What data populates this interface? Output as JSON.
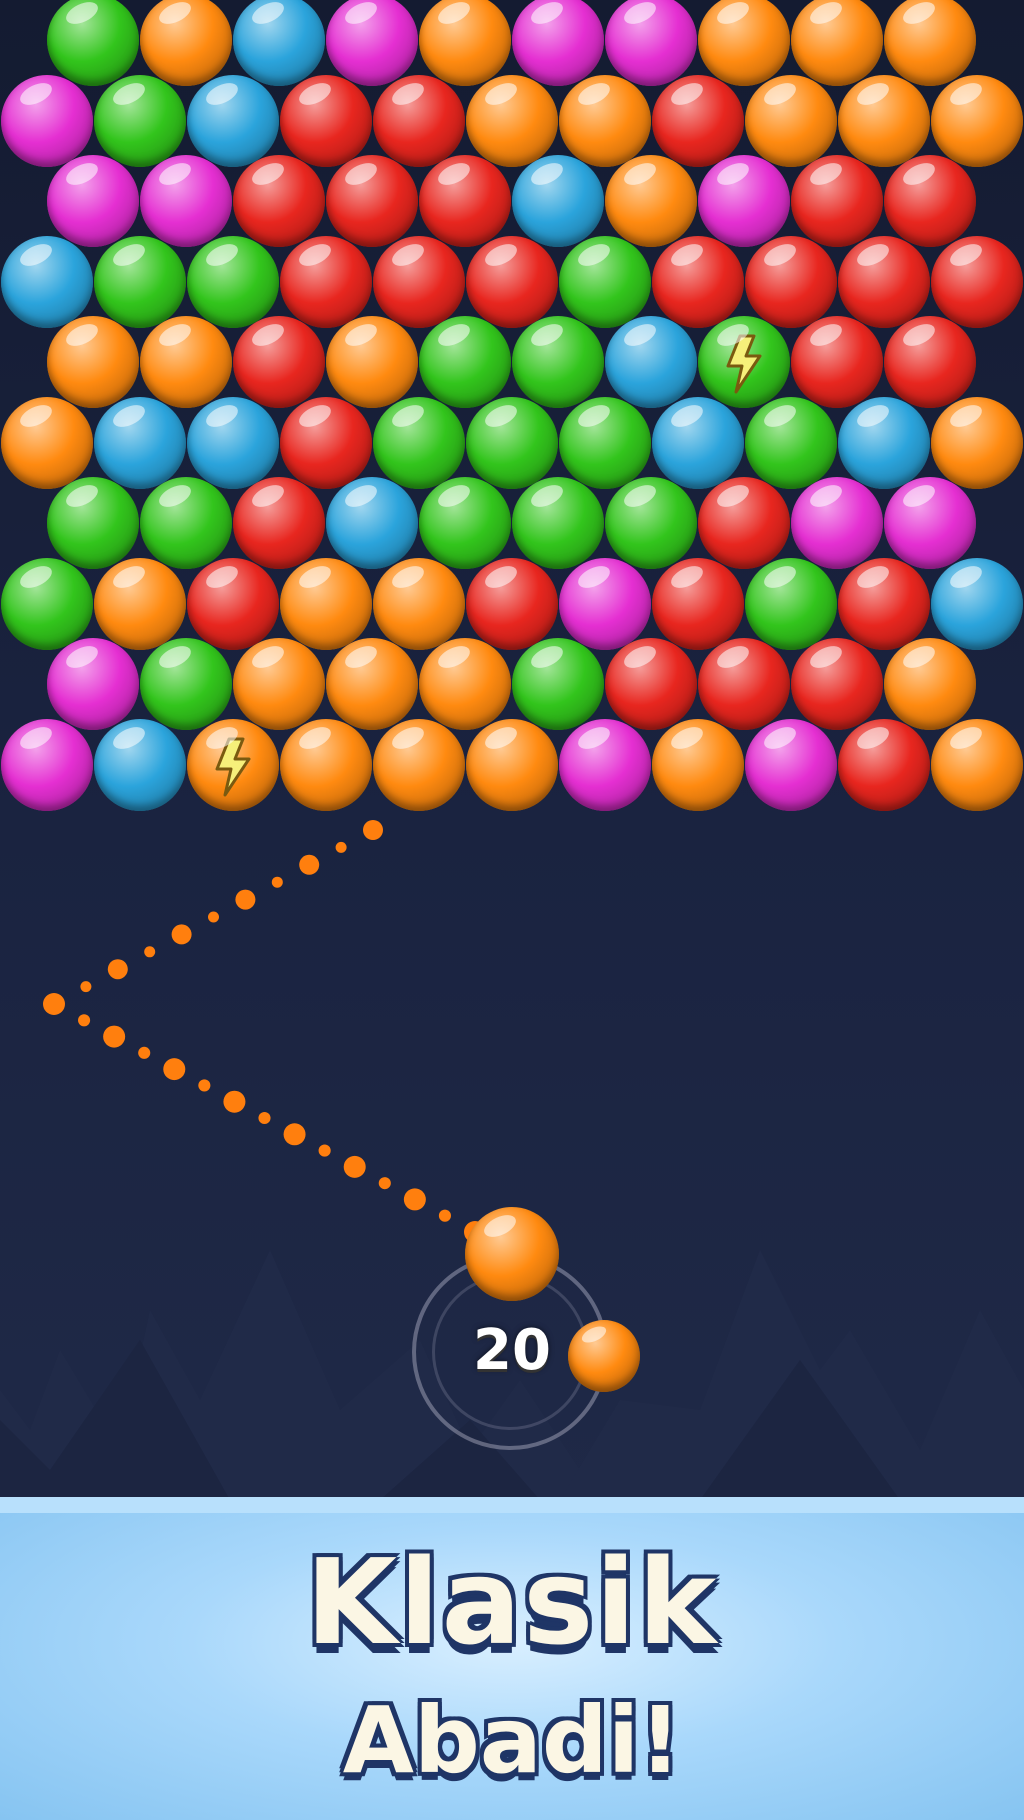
{
  "game": {
    "shots_remaining": "20",
    "current_ball_color": "orange",
    "next_ball_color": "orange",
    "colors": {
      "orange": "#ff8a10",
      "red": "#e8261f",
      "green": "#32c51c",
      "blue": "#2ba4dc",
      "magenta": "#e52fd2"
    },
    "grid": [
      [
        "green",
        "orange",
        "blue",
        "magenta",
        "orange",
        "magenta",
        "magenta",
        "orange",
        "orange",
        "orange"
      ],
      [
        "magenta",
        "green",
        "blue",
        "red",
        "red",
        "orange",
        "orange",
        "red",
        "orange",
        "orange",
        "orange"
      ],
      [
        "magenta",
        "magenta",
        "red",
        "red",
        "red",
        "blue",
        "orange",
        "magenta",
        "red",
        "red"
      ],
      [
        "blue",
        "green",
        "green",
        "red",
        "red",
        "red",
        "green",
        "red",
        "red",
        "red",
        "red"
      ],
      [
        "orange",
        "orange",
        "red",
        "orange",
        "green",
        "green",
        "blue",
        "green",
        "red",
        "red"
      ],
      [
        "orange",
        "blue",
        "blue",
        "red",
        "green",
        "green",
        "green",
        "blue",
        "green",
        "blue",
        "orange"
      ],
      [
        "green",
        "green",
        "red",
        "blue",
        "green",
        "green",
        "green",
        "red",
        "magenta",
        "magenta"
      ],
      [
        "green",
        "orange",
        "red",
        "orange",
        "orange",
        "red",
        "magenta",
        "red",
        "green",
        "red",
        "blue"
      ],
      [
        "magenta",
        "green",
        "orange",
        "orange",
        "orange",
        "green",
        "red",
        "red",
        "red",
        "orange"
      ],
      [
        "magenta",
        "blue",
        "orange",
        "orange",
        "orange",
        "orange",
        "magenta",
        "orange",
        "magenta",
        "red",
        "orange"
      ]
    ],
    "powerups": [
      {
        "row": 4,
        "col": 7,
        "icon": "lightning-bolt-icon"
      },
      {
        "row": 9,
        "col": 2,
        "icon": "lightning-bolt-icon"
      }
    ]
  },
  "banner": {
    "title_line1": "Klasik",
    "title_line2": "Abadi!"
  }
}
